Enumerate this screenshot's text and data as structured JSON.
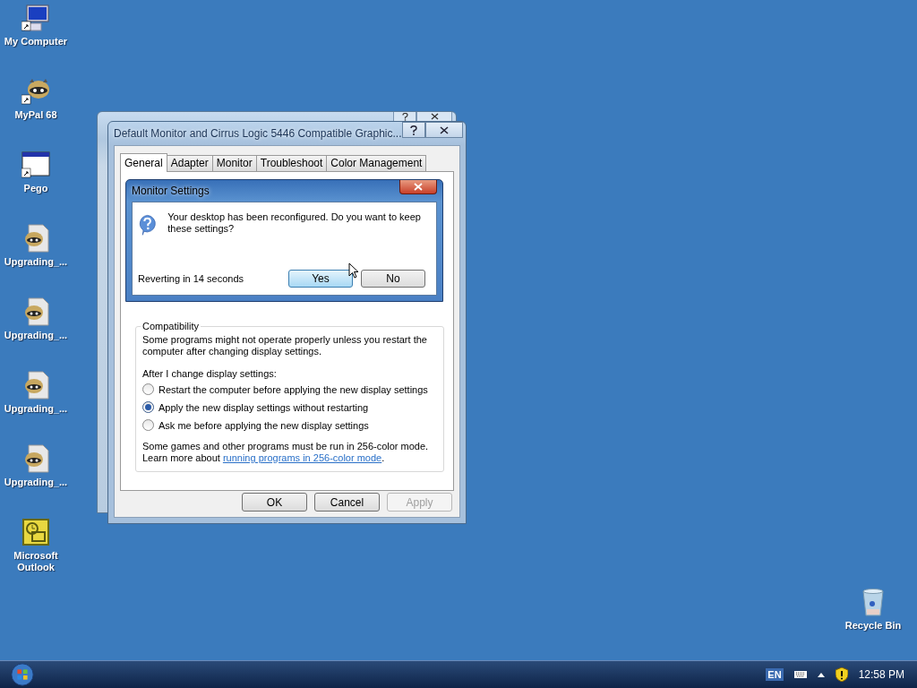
{
  "desktop_icons": [
    {
      "label": "My Computer",
      "kind": "computer"
    },
    {
      "label": "MyPal 68",
      "kind": "raccoon"
    },
    {
      "label": "Pego",
      "kind": "window"
    },
    {
      "label": "Upgrading_...",
      "kind": "document"
    },
    {
      "label": "Upgrading_...",
      "kind": "document"
    },
    {
      "label": "Upgrading_...",
      "kind": "document"
    },
    {
      "label": "Upgrading_...",
      "kind": "document"
    },
    {
      "label": "Microsoft Outlook",
      "kind": "outlook"
    }
  ],
  "recycle_bin": {
    "label": "Recycle Bin"
  },
  "properties_window": {
    "title": "Default Monitor and Cirrus Logic 5446 Compatible Graphic...",
    "tabs": [
      {
        "label": "General",
        "selected": true
      },
      {
        "label": "Adapter",
        "selected": false
      },
      {
        "label": "Monitor",
        "selected": false
      },
      {
        "label": "Troubleshoot",
        "selected": false
      },
      {
        "label": "Color Management",
        "selected": false
      }
    ],
    "compatibility": {
      "legend": "Compatibility",
      "intro": "Some programs might not operate properly unless you restart the computer after changing display settings.",
      "prompt": "After I change display settings:",
      "options": [
        {
          "label": "Restart the computer before applying the new display settings",
          "selected": false
        },
        {
          "label": "Apply the new display settings without restarting",
          "selected": true
        },
        {
          "label": "Ask me before applying the new display settings",
          "selected": false
        }
      ],
      "note": "Some games and other programs must be run in 256-color mode.",
      "learn_prefix": "Learn more about",
      "link": "running programs in 256-color mode",
      "link_suffix": "."
    },
    "buttons": [
      {
        "label": "OK",
        "disabled": false
      },
      {
        "label": "Cancel",
        "disabled": false
      },
      {
        "label": "Apply",
        "disabled": true
      }
    ]
  },
  "monitor_dialog": {
    "title": "Monitor Settings",
    "message": "Your desktop has been reconfigured.  Do you want to keep these settings?",
    "countdown": "Reverting in 14 seconds",
    "buttons": [
      {
        "label": "Yes",
        "focused": true
      },
      {
        "label": "No",
        "focused": false
      }
    ]
  },
  "taskbar": {
    "language": "EN",
    "time": "12:58 PM"
  }
}
